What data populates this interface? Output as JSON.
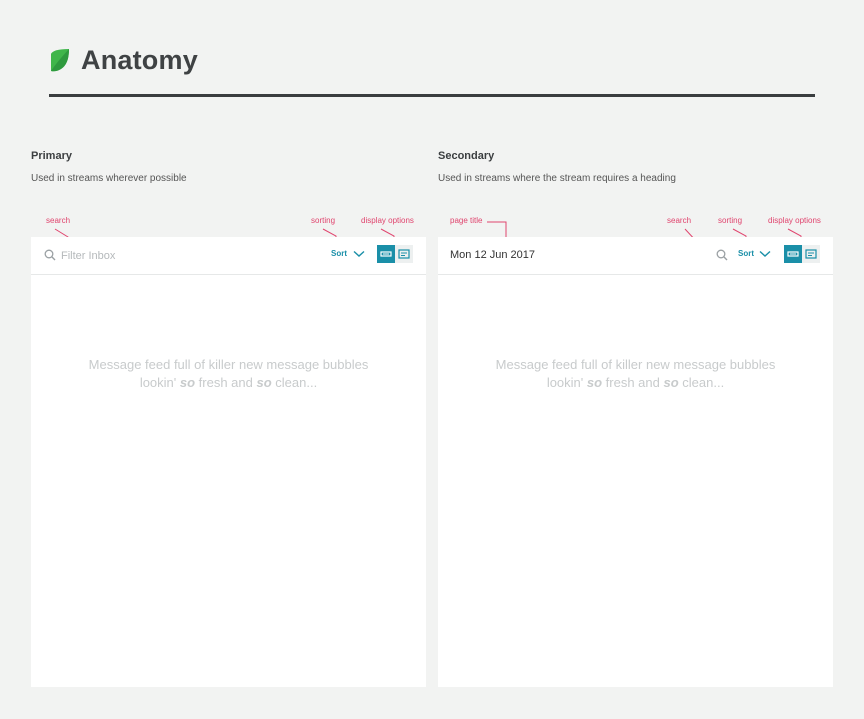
{
  "page": {
    "title": "Anatomy",
    "brand_color": "#3fb64a"
  },
  "primary": {
    "heading": "Primary",
    "description": "Used in streams wherever possible",
    "annotations": {
      "search": "search",
      "sorting": "sorting",
      "display_options": "display options"
    },
    "search": {
      "placeholder": "Filter Inbox",
      "icon": "search-icon"
    },
    "sort_label": "Sort",
    "display_options": [
      {
        "name": "compact-view",
        "active": true
      },
      {
        "name": "expanded-view",
        "active": false
      }
    ],
    "message": {
      "line1": "Message feed full of killer new message bubbles",
      "line2_before": "lookin' ",
      "line2_em1": "so",
      "line2_mid": " fresh and ",
      "line2_em2": "so",
      "line2_after": " clean..."
    }
  },
  "secondary": {
    "heading": "Secondary",
    "description": "Used in streams where the stream requires a heading",
    "annotations": {
      "page_title": "page title",
      "search": "search",
      "sorting": "sorting",
      "display_options": "display options"
    },
    "page_title": "Mon 12 Jun 2017",
    "sort_label": "Sort",
    "message": {
      "line1": "Message feed full of killer new message bubbles",
      "line2_before": "lookin' ",
      "line2_em1": "so",
      "line2_mid": " fresh and ",
      "line2_em2": "so",
      "line2_after": " clean..."
    }
  },
  "colors": {
    "accent": "#1a8fa8",
    "annotation": "#e0446e",
    "rule": "#3a3d3f"
  }
}
